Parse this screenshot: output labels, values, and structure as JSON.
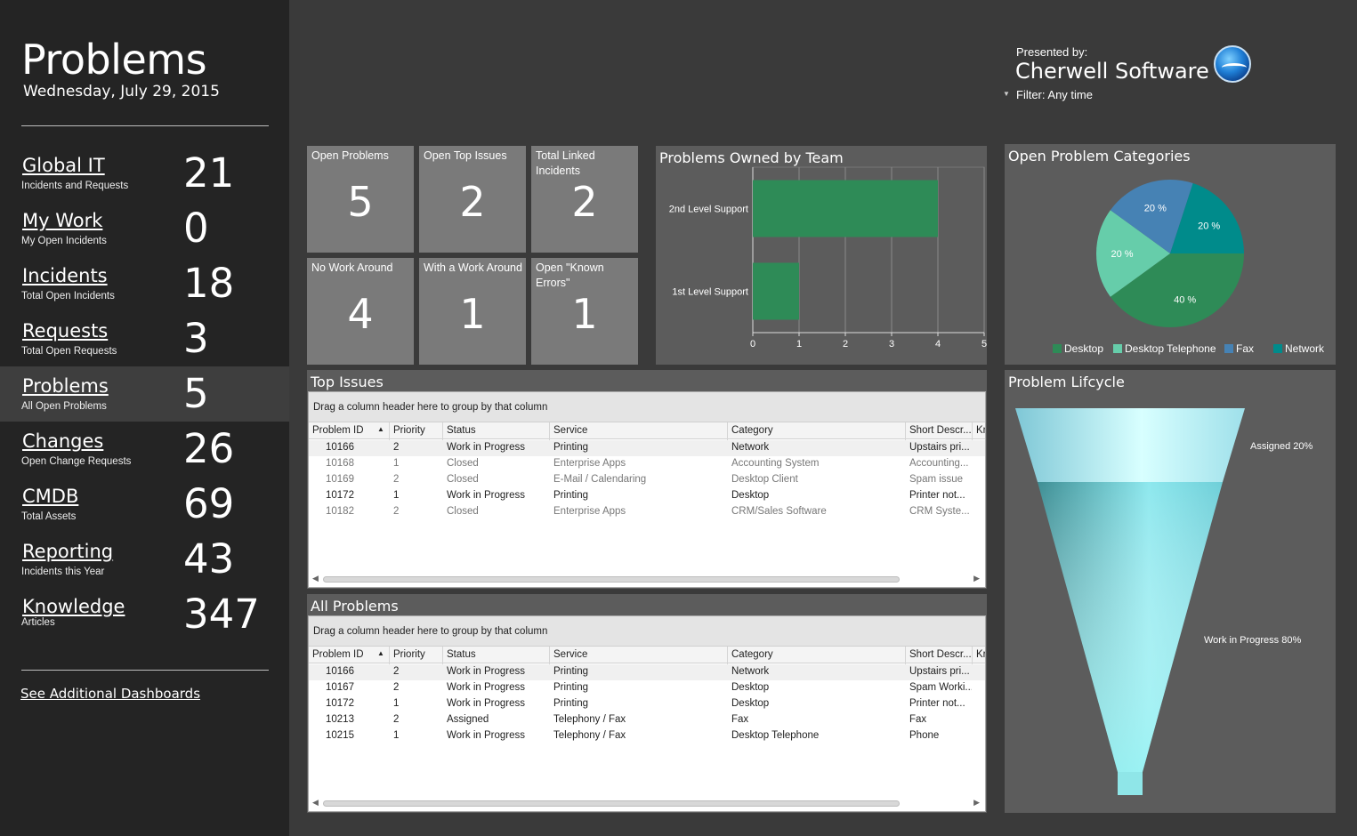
{
  "sidebar": {
    "title": "Problems",
    "date": "Wednesday, July 29, 2015",
    "nav": [
      {
        "label": "Global IT",
        "sub": "Incidents and Requests",
        "count": "21"
      },
      {
        "label": "My Work",
        "sub": "My Open Incidents",
        "count": "0"
      },
      {
        "label": "Incidents",
        "sub": "Total Open Incidents",
        "count": "18"
      },
      {
        "label": "Requests",
        "sub": "Total Open Requests",
        "count": "3"
      },
      {
        "label": "Problems",
        "sub": "All Open Problems",
        "count": "5"
      },
      {
        "label": "Changes",
        "sub": "Open Change Requests",
        "count": "26"
      },
      {
        "label": "CMDB",
        "sub": "Total Assets",
        "count": "69"
      },
      {
        "label": "Reporting",
        "sub": "Incidents this Year",
        "count": "43"
      },
      {
        "label": "Knowledge",
        "sub": "Articles",
        "count": "347"
      }
    ],
    "more_link": "See Additional Dashboards"
  },
  "header": {
    "presented_by": "Presented by:",
    "company": "Cherwell Software",
    "filter": "Filter: Any time",
    "logo_icon": "cherwell-globe-logo"
  },
  "tiles": [
    {
      "label": "Open Problems",
      "value": "5"
    },
    {
      "label": "Open Top Issues",
      "value": "2"
    },
    {
      "label": "Total Linked Incidents",
      "value": "2"
    },
    {
      "label": "No Work Around",
      "value": "4"
    },
    {
      "label": "With a Work Around",
      "value": "1"
    },
    {
      "label": "Open \"Known Errors\"",
      "value": "1"
    }
  ],
  "owned_chart": {
    "title": "Problems Owned by Team",
    "chart_data": {
      "type": "bar",
      "orientation": "horizontal",
      "categories": [
        "2nd Level Support",
        "1st Level Support"
      ],
      "values": [
        4,
        1
      ],
      "xlim": [
        0,
        5
      ],
      "ticks": [
        "0",
        "1",
        "2",
        "3",
        "4",
        "5"
      ],
      "color": "#2e8b57",
      "grid": true
    }
  },
  "categories_chart": {
    "title": "Open Problem Categories",
    "chart_data": {
      "type": "pie",
      "slices": [
        {
          "name": "Desktop",
          "value": 40,
          "label": "40 %",
          "color": "#2e8b57"
        },
        {
          "name": "Desktop Telephone",
          "value": 20,
          "label": "20 %",
          "color": "#66cdaa"
        },
        {
          "name": "Fax",
          "value": 20,
          "label": "20 %",
          "color": "#4682b4"
        },
        {
          "name": "Network",
          "value": 20,
          "label": "20 %",
          "color": "#008b8b"
        }
      ],
      "legend_placement": "bottom"
    }
  },
  "lifecycle": {
    "title": "Problem Lifcycle",
    "chart_data": {
      "type": "funnel",
      "stages": [
        {
          "name": "Assigned",
          "value": 20,
          "label": "Assigned 20%"
        },
        {
          "name": "Work in Progress",
          "value": 80,
          "label": "Work in Progress 80%"
        }
      ]
    }
  },
  "top_issues": {
    "title": "Top Issues",
    "group_hint": "Drag a column header here to group by that column",
    "columns": [
      "Problem ID",
      "Priority",
      "Status",
      "Service",
      "Category",
      "Short Descr...",
      "Kr"
    ],
    "rows": [
      {
        "id": "10166",
        "priority": "2",
        "status": "Work in Progress",
        "service": "Printing",
        "category": "Network",
        "desc": "Upstairs pri...",
        "closed": false
      },
      {
        "id": "10168",
        "priority": "1",
        "status": "Closed",
        "service": "Enterprise Apps",
        "category": "Accounting System",
        "desc": "Accounting...",
        "closed": true
      },
      {
        "id": "10169",
        "priority": "2",
        "status": "Closed",
        "service": "E-Mail / Calendaring",
        "category": "Desktop Client",
        "desc": "Spam issue",
        "closed": true
      },
      {
        "id": "10172",
        "priority": "1",
        "status": "Work in Progress",
        "service": "Printing",
        "category": "Desktop",
        "desc": "Printer not...",
        "closed": false
      },
      {
        "id": "10182",
        "priority": "2",
        "status": "Closed",
        "service": "Enterprise Apps",
        "category": "CRM/Sales Software",
        "desc": "CRM Syste...",
        "closed": true
      }
    ]
  },
  "all_problems": {
    "title": "All Problems",
    "group_hint": "Drag a column header here to group by that column",
    "columns": [
      "Problem ID",
      "Priority",
      "Status",
      "Service",
      "Category",
      "Short Descr...",
      "Kr"
    ],
    "rows": [
      {
        "id": "10166",
        "priority": "2",
        "status": "Work in Progress",
        "service": "Printing",
        "category": "Network",
        "desc": "Upstairs pri...",
        "closed": false
      },
      {
        "id": "10167",
        "priority": "2",
        "status": "Work in Progress",
        "service": "Printing",
        "category": "Desktop",
        "desc": "Spam Worki...",
        "closed": false
      },
      {
        "id": "10172",
        "priority": "1",
        "status": "Work in Progress",
        "service": "Printing",
        "category": "Desktop",
        "desc": "Printer not...",
        "closed": false
      },
      {
        "id": "10213",
        "priority": "2",
        "status": "Assigned",
        "service": "Telephony / Fax",
        "category": "Fax",
        "desc": "Fax",
        "closed": false
      },
      {
        "id": "10215",
        "priority": "1",
        "status": "Work in Progress",
        "service": "Telephony / Fax",
        "category": "Desktop Telephone",
        "desc": "Phone",
        "closed": false
      }
    ]
  }
}
